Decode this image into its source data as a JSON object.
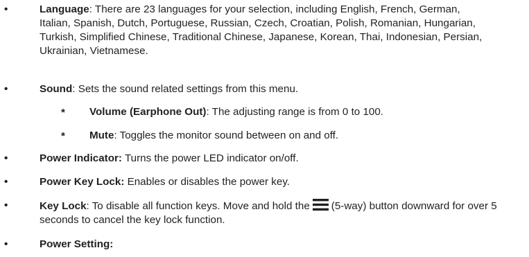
{
  "bullet_symbol": "•",
  "sub_symbol": "*",
  "items": [
    {
      "term": "Language",
      "sep": ":",
      "desc": " There are 23 languages for your selection, including English, French, German, Italian, Spanish, Dutch, Portuguese, Russian, Czech, Croatian, Polish, Romanian, Hungarian, Turkish, Simplified Chinese, Traditional Chinese, Japanese, Korean, Thai, Indonesian, Persian, Ukrainian, Vietnamese."
    },
    {
      "term": "Sound",
      "sep": ":",
      "desc": " Sets the sound related settings from this menu."
    },
    {
      "term": "Power Indicator:",
      "sep": "",
      "desc": " Turns the power LED indicator on/off."
    },
    {
      "term": "Power Key Lock:",
      "sep": "",
      "desc": " Enables or disables the power key."
    },
    {
      "term": "Key Lock",
      "sep": ":",
      "desc_before_icon": " To disable all function keys. Move and hold the",
      "icon": "menu-icon",
      "desc_after_icon": "(5-way) button downward for over 5 seconds to cancel the key lock function."
    },
    {
      "term": "Power Setting:",
      "sep": "",
      "desc": ""
    }
  ],
  "sound_subitems": [
    {
      "term": "Volume (Earphone Out)",
      "sep": ":",
      "desc": " The adjusting range is from 0 to 100."
    },
    {
      "term": "Mute",
      "sep": ":",
      "desc": " Toggles the monitor sound between on and off."
    }
  ]
}
